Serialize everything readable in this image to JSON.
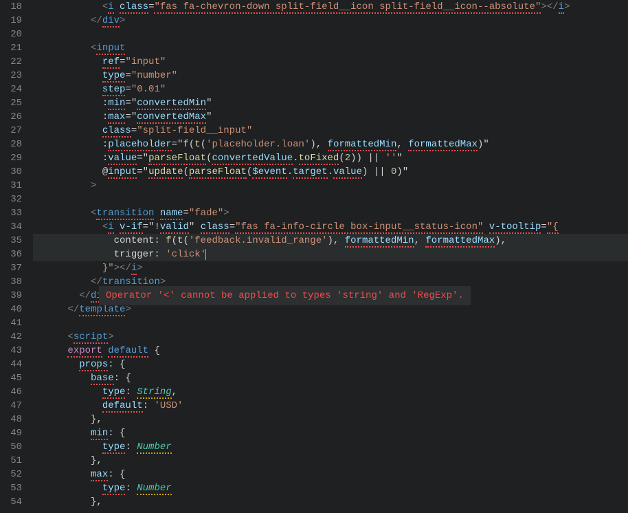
{
  "firstLine": 18,
  "lastLine": 54,
  "highlightLines": [
    35,
    36
  ],
  "errorTooltip": "Operator '<' cannot be applied to types 'string' and 'RegExp'.",
  "lines": {
    "18": {
      "indent": 6,
      "tokens": [
        {
          "t": "tag-br",
          "s": "<"
        },
        {
          "t": "tag sq-red",
          "s": "i"
        },
        {
          "t": "plain",
          "s": " "
        },
        {
          "t": "attr sq-red",
          "s": "class"
        },
        {
          "t": "plain",
          "s": "="
        },
        {
          "t": "str sq-red",
          "s": "\"fas fa-chevron-down split-field__icon split-field__icon--absolute\""
        },
        {
          "t": "tag-br",
          "s": "></"
        },
        {
          "t": "tag sq-red",
          "s": "i"
        },
        {
          "t": "tag-br",
          "s": ">"
        }
      ]
    },
    "19": {
      "indent": 5,
      "tokens": [
        {
          "t": "tag-br",
          "s": "</"
        },
        {
          "t": "tag sq-red",
          "s": "div"
        },
        {
          "t": "tag-br",
          "s": ">"
        }
      ]
    },
    "20": {
      "indent": 0,
      "tokens": []
    },
    "21": {
      "indent": 5,
      "tokens": [
        {
          "t": "tag-br",
          "s": "<"
        },
        {
          "t": "tag sq-red",
          "s": "input"
        }
      ]
    },
    "22": {
      "indent": 6,
      "tokens": [
        {
          "t": "attr sq-red",
          "s": "ref"
        },
        {
          "t": "plain",
          "s": "="
        },
        {
          "t": "str",
          "s": "\"input\""
        }
      ]
    },
    "23": {
      "indent": 6,
      "tokens": [
        {
          "t": "attr sq-red",
          "s": "type"
        },
        {
          "t": "plain",
          "s": "="
        },
        {
          "t": "str",
          "s": "\"number\""
        }
      ]
    },
    "24": {
      "indent": 6,
      "tokens": [
        {
          "t": "attr sq-red",
          "s": "step"
        },
        {
          "t": "plain",
          "s": "="
        },
        {
          "t": "str",
          "s": "\"0.01\""
        }
      ]
    },
    "25": {
      "indent": 6,
      "tokens": [
        {
          "t": "plain",
          "s": ":"
        },
        {
          "t": "attr sq-red",
          "s": "min"
        },
        {
          "t": "plain",
          "s": "=\""
        },
        {
          "t": "val sq-red",
          "s": "convertedMin"
        },
        {
          "t": "plain",
          "s": "\""
        }
      ]
    },
    "26": {
      "indent": 6,
      "tokens": [
        {
          "t": "plain",
          "s": ":"
        },
        {
          "t": "attr sq-red",
          "s": "max"
        },
        {
          "t": "plain",
          "s": "=\""
        },
        {
          "t": "val sq-red",
          "s": "convertedMax"
        },
        {
          "t": "plain",
          "s": "\""
        }
      ]
    },
    "27": {
      "indent": 6,
      "tokens": [
        {
          "t": "attr sq-red",
          "s": "class"
        },
        {
          "t": "plain",
          "s": "="
        },
        {
          "t": "str",
          "s": "\"split-field__input\""
        }
      ]
    },
    "28": {
      "indent": 6,
      "tokens": [
        {
          "t": "plain",
          "s": ":"
        },
        {
          "t": "attr sq-red",
          "s": "placeholder"
        },
        {
          "t": "plain",
          "s": "=\""
        },
        {
          "t": "fn",
          "s": "f"
        },
        {
          "t": "plain",
          "s": "("
        },
        {
          "t": "fn",
          "s": "t"
        },
        {
          "t": "plain",
          "s": "("
        },
        {
          "t": "str",
          "s": "'placeholder.loan'"
        },
        {
          "t": "plain",
          "s": "), "
        },
        {
          "t": "val sq-red",
          "s": "formattedMin"
        },
        {
          "t": "plain",
          "s": ", "
        },
        {
          "t": "val sq-red",
          "s": "formattedMax"
        },
        {
          "t": "plain",
          "s": ")\""
        }
      ]
    },
    "29": {
      "indent": 6,
      "tokens": [
        {
          "t": "plain",
          "s": ":"
        },
        {
          "t": "attr sq-red",
          "s": "value"
        },
        {
          "t": "plain",
          "s": "=\""
        },
        {
          "t": "fn sq-red",
          "s": "parseFloat"
        },
        {
          "t": "plain",
          "s": "("
        },
        {
          "t": "val sq-red",
          "s": "convertedValue"
        },
        {
          "t": "plain",
          "s": "."
        },
        {
          "t": "fn sq-red",
          "s": "toFixed"
        },
        {
          "t": "plain",
          "s": "("
        },
        {
          "t": "num",
          "s": "2"
        },
        {
          "t": "plain",
          "s": ")) || "
        },
        {
          "t": "str",
          "s": "''"
        },
        {
          "t": "plain",
          "s": "\""
        }
      ]
    },
    "30": {
      "indent": 6,
      "tokens": [
        {
          "t": "plain",
          "s": "@"
        },
        {
          "t": "attr sq-red",
          "s": "input"
        },
        {
          "t": "plain",
          "s": "=\""
        },
        {
          "t": "fn sq-red",
          "s": "update"
        },
        {
          "t": "plain",
          "s": "("
        },
        {
          "t": "fn sq-red",
          "s": "parseFloat"
        },
        {
          "t": "plain",
          "s": "("
        },
        {
          "t": "val sq-red",
          "s": "$event"
        },
        {
          "t": "plain",
          "s": "."
        },
        {
          "t": "val sq-red",
          "s": "target"
        },
        {
          "t": "plain",
          "s": "."
        },
        {
          "t": "val sq-red",
          "s": "value"
        },
        {
          "t": "plain",
          "s": ") || "
        },
        {
          "t": "num",
          "s": "0"
        },
        {
          "t": "plain",
          "s": ")\""
        }
      ]
    },
    "31": {
      "indent": 5,
      "tokens": [
        {
          "t": "tag-br",
          "s": ">"
        }
      ]
    },
    "32": {
      "indent": 0,
      "tokens": []
    },
    "33": {
      "indent": 5,
      "tokens": [
        {
          "t": "tag-br",
          "s": "<"
        },
        {
          "t": "tag sq-red",
          "s": "transition"
        },
        {
          "t": "plain",
          "s": " "
        },
        {
          "t": "attr sq-red",
          "s": "name"
        },
        {
          "t": "plain",
          "s": "="
        },
        {
          "t": "str",
          "s": "\"fade\""
        },
        {
          "t": "tag-br",
          "s": ">"
        }
      ]
    },
    "34": {
      "indent": 6,
      "tokens": [
        {
          "t": "tag-br",
          "s": "<"
        },
        {
          "t": "tag sq-red",
          "s": "i"
        },
        {
          "t": "plain",
          "s": " "
        },
        {
          "t": "attr sq-red",
          "s": "v-if"
        },
        {
          "t": "plain",
          "s": "=\"!"
        },
        {
          "t": "val sq-red",
          "s": "valid"
        },
        {
          "t": "plain",
          "s": "\" "
        },
        {
          "t": "attr sq-red",
          "s": "class"
        },
        {
          "t": "plain",
          "s": "="
        },
        {
          "t": "str sq-red",
          "s": "\"fas fa-info-circle box-input__status-icon\""
        },
        {
          "t": "plain",
          "s": " "
        },
        {
          "t": "attr sq-red",
          "s": "v-tooltip"
        },
        {
          "t": "plain",
          "s": "="
        },
        {
          "t": "str sq-red",
          "s": "\"{"
        }
      ]
    },
    "35": {
      "indent": 7,
      "tokens": [
        {
          "t": "plain",
          "s": "content: "
        },
        {
          "t": "fn",
          "s": "f"
        },
        {
          "t": "plain",
          "s": "("
        },
        {
          "t": "fn",
          "s": "t"
        },
        {
          "t": "plain",
          "s": "("
        },
        {
          "t": "str",
          "s": "'feedback.invalid_range'"
        },
        {
          "t": "plain",
          "s": "), "
        },
        {
          "t": "val sq-red",
          "s": "formattedMin"
        },
        {
          "t": "plain",
          "s": ", "
        },
        {
          "t": "val sq-red",
          "s": "formattedMax"
        },
        {
          "t": "plain",
          "s": "),"
        }
      ]
    },
    "36": {
      "indent": 7,
      "tokens": [
        {
          "t": "plain",
          "s": "trigger: "
        },
        {
          "t": "str",
          "s": "'click'"
        },
        {
          "t": "cursor",
          "s": ""
        }
      ]
    },
    "37": {
      "indent": 6,
      "tokens": [
        {
          "t": "str",
          "s": "}\""
        },
        {
          "t": "tag-br",
          "s": "></"
        },
        {
          "t": "tag sq-red",
          "s": "i"
        },
        {
          "t": "tag-br",
          "s": ">"
        }
      ]
    },
    "38": {
      "indent": 5,
      "tokens": [
        {
          "t": "tag-br",
          "s": "</"
        },
        {
          "t": "tag sq-red",
          "s": "transition"
        },
        {
          "t": "tag-br",
          "s": ">"
        }
      ]
    },
    "39": {
      "indent": 4,
      "tokens": [
        {
          "t": "tag-br",
          "s": "</"
        },
        {
          "t": "tag sq-red",
          "s": "div"
        },
        {
          "t": "tag-br",
          "s": ">"
        }
      ]
    },
    "40": {
      "indent": 3,
      "tokens": [
        {
          "t": "tag-br",
          "s": "</"
        },
        {
          "t": "tag sq-red",
          "s": "template"
        },
        {
          "t": "tag-br",
          "s": ">"
        }
      ]
    },
    "41": {
      "indent": 0,
      "tokens": []
    },
    "42": {
      "indent": 3,
      "tokens": [
        {
          "t": "tag-br",
          "s": "<"
        },
        {
          "t": "tag sq-red",
          "s": "script"
        },
        {
          "t": "tag-br",
          "s": ">"
        }
      ]
    },
    "43": {
      "indent": 3,
      "tokens": [
        {
          "t": "kw sq-red",
          "s": "export"
        },
        {
          "t": "plain",
          "s": " "
        },
        {
          "t": "tag sq-red",
          "s": "default"
        },
        {
          "t": "plain",
          "s": " {"
        }
      ]
    },
    "44": {
      "indent": 4,
      "tokens": [
        {
          "t": "attr sq-red",
          "s": "props"
        },
        {
          "t": "plain",
          "s": ": {"
        }
      ]
    },
    "45": {
      "indent": 5,
      "tokens": [
        {
          "t": "attr sq-red",
          "s": "base"
        },
        {
          "t": "plain",
          "s": ": {"
        }
      ]
    },
    "46": {
      "indent": 6,
      "tokens": [
        {
          "t": "attr sq-red",
          "s": "type"
        },
        {
          "t": "plain",
          "s": ": "
        },
        {
          "t": "type sq-yel",
          "s": "String"
        },
        {
          "t": "plain",
          "s": ","
        }
      ]
    },
    "47": {
      "indent": 6,
      "tokens": [
        {
          "t": "attr sq-red",
          "s": "default"
        },
        {
          "t": "plain",
          "s": ": "
        },
        {
          "t": "str",
          "s": "'USD'"
        }
      ]
    },
    "48": {
      "indent": 5,
      "tokens": [
        {
          "t": "plain",
          "s": "},"
        }
      ]
    },
    "49": {
      "indent": 5,
      "tokens": [
        {
          "t": "attr sq-red",
          "s": "min"
        },
        {
          "t": "plain",
          "s": ": {"
        }
      ]
    },
    "50": {
      "indent": 6,
      "tokens": [
        {
          "t": "attr sq-red",
          "s": "type"
        },
        {
          "t": "plain",
          "s": ": "
        },
        {
          "t": "type sq-yel",
          "s": "Number"
        }
      ]
    },
    "51": {
      "indent": 5,
      "tokens": [
        {
          "t": "plain",
          "s": "},"
        }
      ]
    },
    "52": {
      "indent": 5,
      "tokens": [
        {
          "t": "attr sq-red",
          "s": "max"
        },
        {
          "t": "plain",
          "s": ": {"
        }
      ]
    },
    "53": {
      "indent": 6,
      "tokens": [
        {
          "t": "attr sq-red",
          "s": "type"
        },
        {
          "t": "plain",
          "s": ": "
        },
        {
          "t": "type sq-yel",
          "s": "Number"
        }
      ]
    },
    "54": {
      "indent": 5,
      "tokens": [
        {
          "t": "plain",
          "s": "},"
        }
      ]
    }
  }
}
